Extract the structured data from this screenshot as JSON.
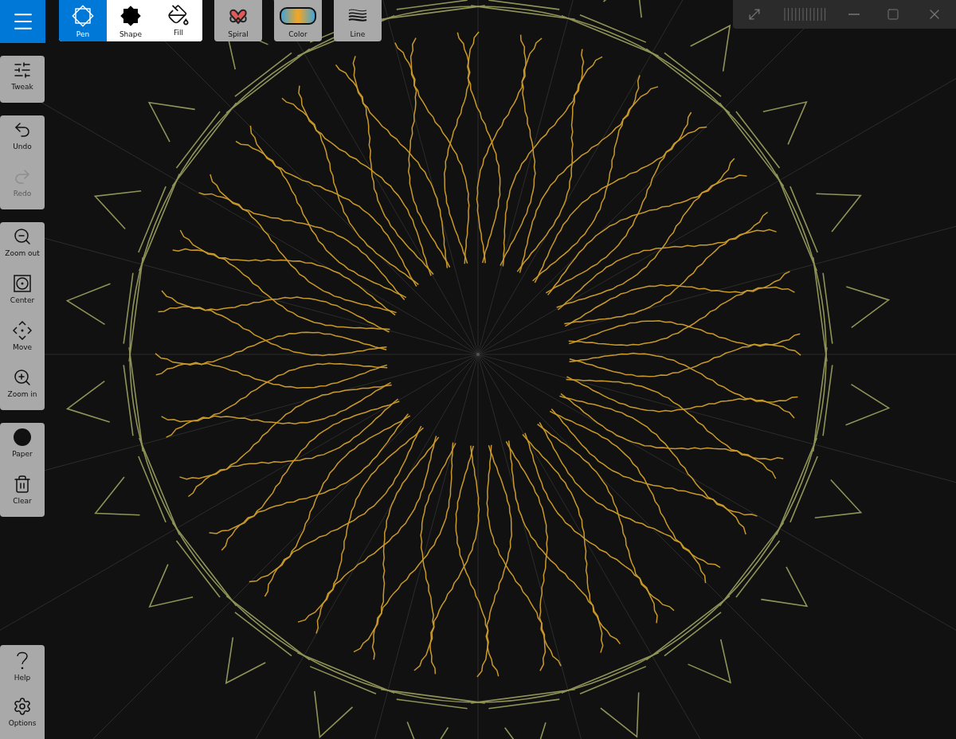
{
  "menu_button": {
    "kind": "menu"
  },
  "tools": [
    {
      "label": "Pen",
      "kind": "pen",
      "selected": true
    },
    {
      "label": "Shape",
      "kind": "shape",
      "selected": false
    },
    {
      "label": "Fill",
      "kind": "fill",
      "selected": false
    }
  ],
  "style_buttons": [
    {
      "label": "Spiral",
      "kind": "spiral"
    },
    {
      "label": "Color",
      "kind": "color"
    },
    {
      "label": "Line",
      "kind": "line"
    }
  ],
  "sidebar_groups": [
    {
      "items": [
        {
          "label": "Tweak",
          "kind": "tweak",
          "disabled": false
        }
      ]
    },
    {
      "items": [
        {
          "label": "Undo",
          "kind": "undo",
          "disabled": false
        },
        {
          "label": "Redo",
          "kind": "redo",
          "disabled": true
        }
      ]
    },
    {
      "items": [
        {
          "label": "Zoom out",
          "kind": "zoomout",
          "disabled": false
        },
        {
          "label": "Center",
          "kind": "center",
          "disabled": false
        },
        {
          "label": "Move",
          "kind": "move",
          "disabled": false
        },
        {
          "label": "Zoom in",
          "kind": "zoomin",
          "disabled": false
        }
      ]
    },
    {
      "items": [
        {
          "label": "Paper",
          "kind": "paper",
          "disabled": false
        },
        {
          "label": "Clear",
          "kind": "clear",
          "disabled": false
        }
      ]
    }
  ],
  "sidebar_bottom": {
    "items": [
      {
        "label": "Help",
        "kind": "help",
        "disabled": false
      },
      {
        "label": "Options",
        "kind": "options",
        "disabled": false
      }
    ]
  },
  "window_controls": [
    {
      "kind": "fullscreen"
    },
    {
      "kind": "grip"
    },
    {
      "kind": "minimize"
    },
    {
      "kind": "maximize"
    },
    {
      "kind": "close"
    }
  ]
}
